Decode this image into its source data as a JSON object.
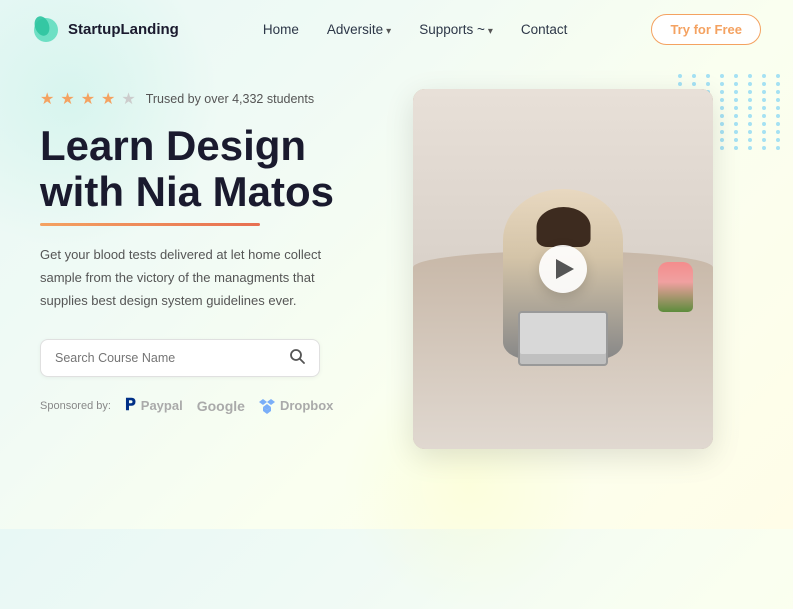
{
  "nav": {
    "logo_text": "StartupLanding",
    "links": [
      {
        "label": "Home",
        "has_dropdown": false
      },
      {
        "label": "Adversite",
        "has_dropdown": true
      },
      {
        "label": "Supports ~",
        "has_dropdown": true
      },
      {
        "label": "Contact",
        "has_dropdown": false
      }
    ],
    "cta_label": "Try for Free"
  },
  "hero": {
    "trust_rating": "★★★★",
    "trust_text": "Trused by over 4,332 students",
    "title_line1": "Learn Design",
    "title_line2": "with Nia Matos",
    "description": "Get your blood tests delivered at let home collect sample from the victory of the managments that supplies best design system guidelines ever.",
    "search_placeholder": "Search Course Name"
  },
  "sponsors": {
    "label": "Sponsored by:",
    "items": [
      {
        "name": "Paypal",
        "icon": "paypal"
      },
      {
        "name": "Google",
        "icon": "google"
      },
      {
        "name": "Dropbox",
        "icon": "dropbox"
      }
    ]
  }
}
